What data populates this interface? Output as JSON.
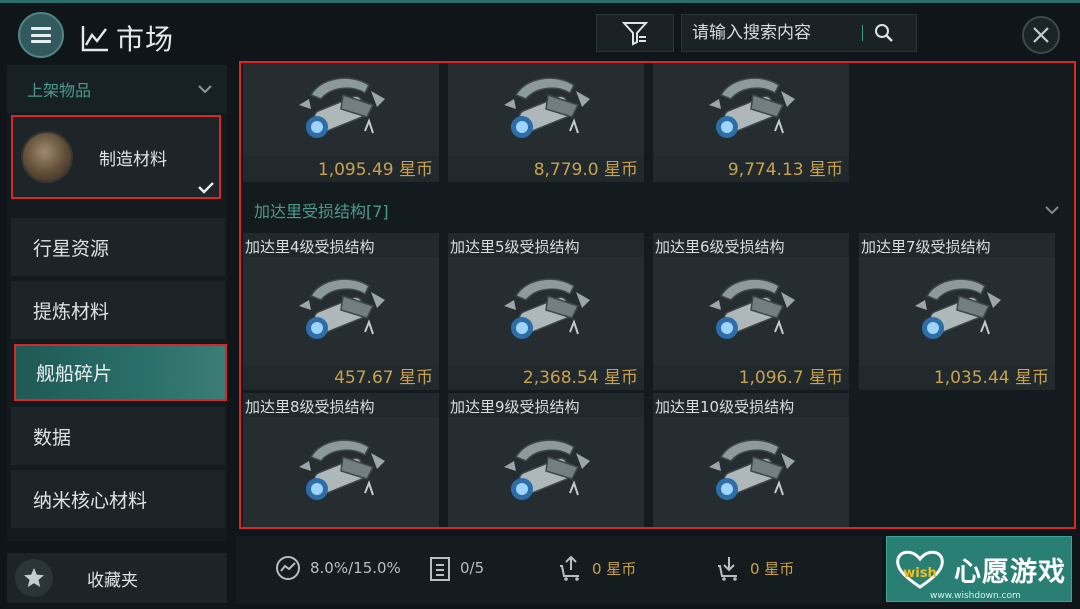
{
  "header": {
    "title": "市场",
    "search_placeholder": "请输入搜索内容"
  },
  "sidebar": {
    "section_title": "上架物品",
    "selected_item": "制造材料",
    "categories": [
      {
        "label": "行星资源"
      },
      {
        "label": "提炼材料"
      },
      {
        "label": "舰船碎片",
        "active": true
      },
      {
        "label": "数据"
      },
      {
        "label": "纳米核心材料"
      }
    ],
    "favorites_label": "收藏夹"
  },
  "content": {
    "top_row": [
      {
        "price": "1,095.49 星币"
      },
      {
        "price": "8,779.0 星币"
      },
      {
        "price": "9,774.13 星币"
      }
    ],
    "group": {
      "title": "加达里受损结构[7]",
      "items": [
        {
          "name": "加达里4级受损结构",
          "price": "457.67 星币"
        },
        {
          "name": "加达里5级受损结构",
          "price": "2,368.54 星币"
        },
        {
          "name": "加达里6级受损结构",
          "price": "1,096.7 星币"
        },
        {
          "name": "加达里7级受损结构",
          "price": "1,035.44 星币"
        },
        {
          "name": "加达里8级受损结构",
          "price": ""
        },
        {
          "name": "加达里9级受损结构",
          "price": ""
        },
        {
          "name": "加达里10级受损结构",
          "price": ""
        }
      ]
    }
  },
  "footer": {
    "tax": "8.0%/15.0%",
    "orders": "0/5",
    "sell_amount": "0 星币",
    "buy_amount": "0 星币"
  },
  "watermark": {
    "logo_text": "wish",
    "brand": "心愿游戏",
    "url": "www.wishdown.com"
  },
  "colors": {
    "accent": "#2a7f75",
    "price": "#c9a24d",
    "highlight_border": "#d8262a",
    "section_text": "#4c9a8e"
  },
  "icons": [
    "menu-icon",
    "chart-icon",
    "filter-icon",
    "search-icon",
    "close-icon",
    "chevron-down-icon",
    "star-icon",
    "gauge-icon",
    "clipboard-icon",
    "sell-icon",
    "buy-icon"
  ]
}
